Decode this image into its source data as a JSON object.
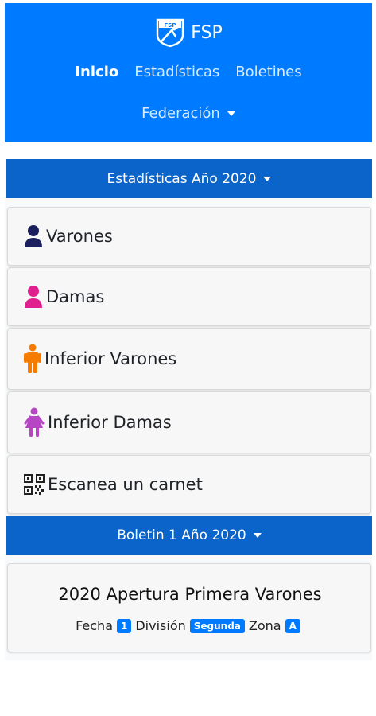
{
  "navbar": {
    "brand_logo_text": "FSP",
    "brand_text": "FSP",
    "links": [
      {
        "label": "Inicio",
        "active": true
      },
      {
        "label": "Estadísticas",
        "active": false
      },
      {
        "label": "Boletines",
        "active": false
      }
    ],
    "dropdown_label": "Federación",
    "background": "#007bff"
  },
  "stats_section": {
    "header_label": "Estadísticas Año 2020",
    "items": [
      {
        "label": "Varones",
        "icon": "male-user-icon",
        "icon_color": "#1b1f5e"
      },
      {
        "label": "Damas",
        "icon": "female-user-icon",
        "icon_color": "#e0208f"
      },
      {
        "label": "Inferior Varones",
        "icon": "male-figure-icon",
        "icon_color": "#f57c00"
      },
      {
        "label": "Inferior Damas",
        "icon": "female-figure-icon",
        "icon_color": "#b646c4"
      },
      {
        "label": "Escanea un carnet",
        "icon": "qr-code-icon",
        "icon_color": "#222222"
      }
    ]
  },
  "boletin_section": {
    "header_label": "Boletin 1 Año 2020",
    "card": {
      "title": "2020 Apertura Primera Varones",
      "fecha_label": "Fecha",
      "fecha_value": "1",
      "division_label": "División",
      "division_value": "Segunda",
      "zona_label": "Zona",
      "zona_value": "A"
    }
  }
}
